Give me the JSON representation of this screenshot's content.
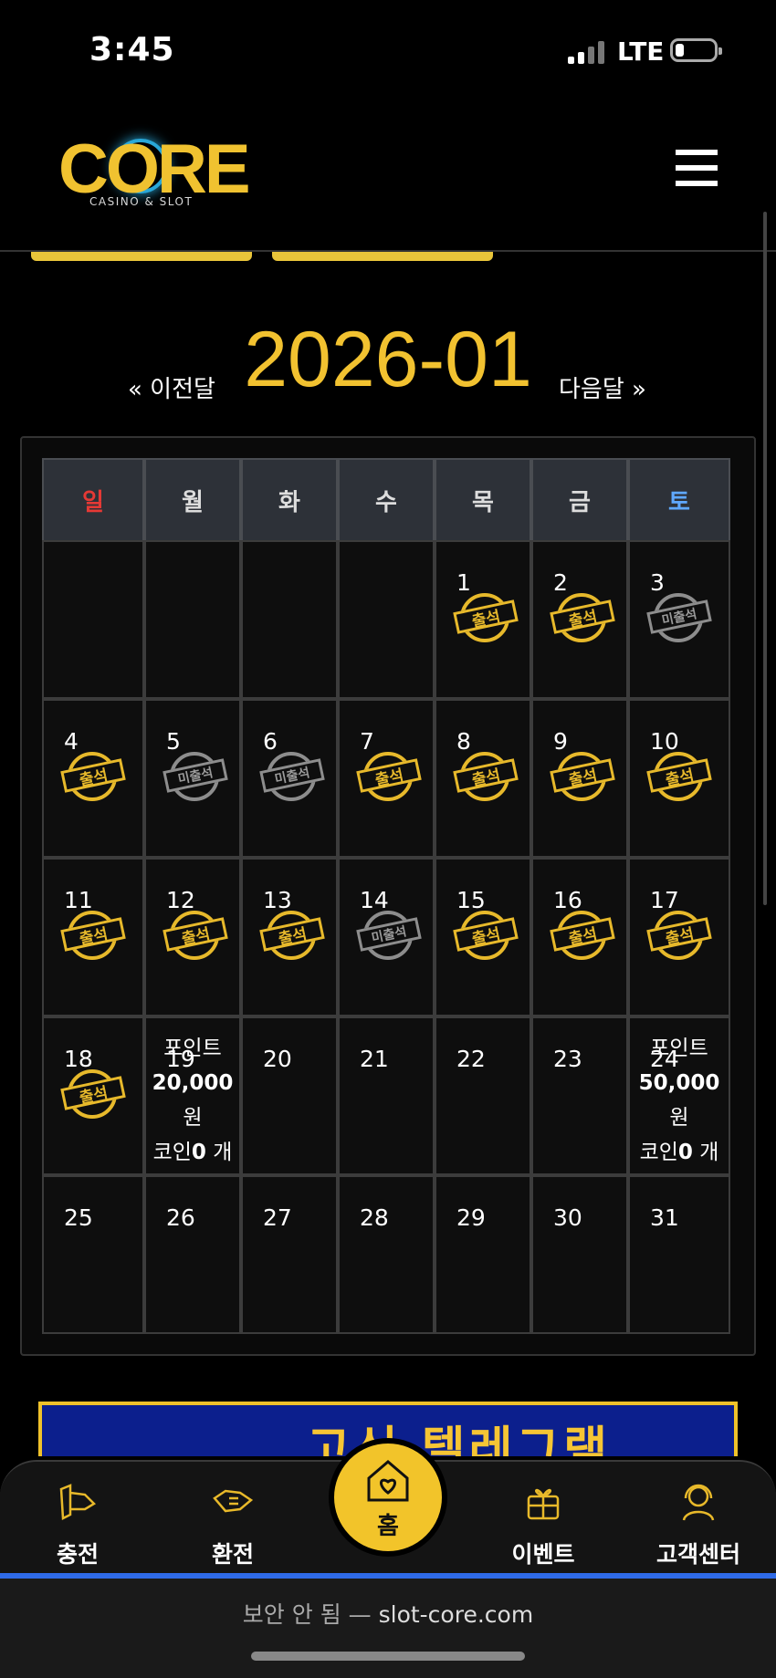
{
  "status": {
    "time": "3:45",
    "network": "LTE"
  },
  "header": {
    "logo_text": "CORE",
    "logo_sub": "CASINO & SLOT"
  },
  "calendar": {
    "month": "2026-01",
    "prev_label": "« 이전달",
    "next_label": "다음달 »",
    "weekdays": [
      "일",
      "월",
      "화",
      "수",
      "목",
      "금",
      "토"
    ],
    "attended_label": "출석",
    "absent_label": "미출석",
    "days": [
      {
        "d": "1",
        "s": "attended"
      },
      {
        "d": "2",
        "s": "attended"
      },
      {
        "d": "3",
        "s": "absent"
      },
      {
        "d": "4",
        "s": "attended"
      },
      {
        "d": "5",
        "s": "absent"
      },
      {
        "d": "6",
        "s": "absent"
      },
      {
        "d": "7",
        "s": "attended"
      },
      {
        "d": "8",
        "s": "attended"
      },
      {
        "d": "9",
        "s": "attended"
      },
      {
        "d": "10",
        "s": "attended"
      },
      {
        "d": "11",
        "s": "attended"
      },
      {
        "d": "12",
        "s": "attended"
      },
      {
        "d": "13",
        "s": "attended"
      },
      {
        "d": "14",
        "s": "absent"
      },
      {
        "d": "15",
        "s": "attended"
      },
      {
        "d": "16",
        "s": "attended"
      },
      {
        "d": "17",
        "s": "attended"
      },
      {
        "d": "18",
        "s": "attended"
      },
      {
        "d": "19",
        "s": ""
      },
      {
        "d": "20",
        "s": ""
      },
      {
        "d": "21",
        "s": ""
      },
      {
        "d": "22",
        "s": ""
      },
      {
        "d": "23",
        "s": ""
      },
      {
        "d": "24",
        "s": ""
      },
      {
        "d": "25",
        "s": ""
      },
      {
        "d": "26",
        "s": ""
      },
      {
        "d": "27",
        "s": ""
      },
      {
        "d": "28",
        "s": ""
      },
      {
        "d": "29",
        "s": ""
      },
      {
        "d": "30",
        "s": ""
      },
      {
        "d": "31",
        "s": ""
      }
    ],
    "rewards": {
      "19": {
        "label": "포인트",
        "amount": "20,000",
        "unit": "원",
        "coin_label": "코인",
        "coin": "0",
        "coin_unit": "개"
      },
      "24": {
        "label": "포인트",
        "amount": "50,000",
        "unit": "원",
        "coin_label": "코인",
        "coin": "0",
        "coin_unit": "개"
      }
    }
  },
  "banner": {
    "text": "고신 텔레그램"
  },
  "bottom_nav": {
    "items": [
      {
        "label": "충전",
        "icon": "deposit-icon"
      },
      {
        "label": "환전",
        "icon": "withdraw-icon"
      },
      {
        "label": "홈",
        "icon": "home-heart-icon"
      },
      {
        "label": "이벤트",
        "icon": "gift-icon"
      },
      {
        "label": "고객센터",
        "icon": "support-icon"
      }
    ]
  },
  "browser": {
    "insecure": "보안 안 됨 —",
    "url": "slot-core.com"
  },
  "colors": {
    "gold": "#f2c230",
    "sunday": "#e53935",
    "saturday": "#5fa8ff",
    "url_bar": "#2f6be8"
  }
}
